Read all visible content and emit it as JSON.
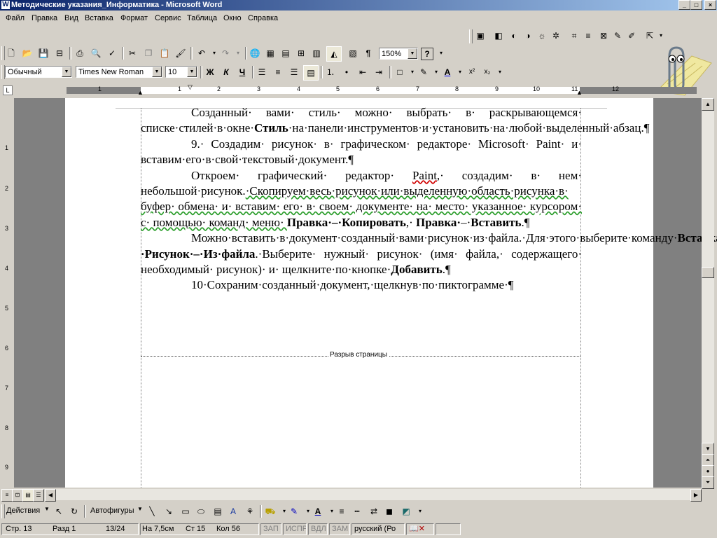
{
  "window": {
    "title": "Методические указания_Информатика - Microsoft Word",
    "min": "_",
    "max": "□",
    "close": "×"
  },
  "menu": [
    "Файл",
    "Правка",
    "Вид",
    "Вставка",
    "Формат",
    "Сервис",
    "Таблица",
    "Окно",
    "Справка"
  ],
  "formatting": {
    "style": "Обычный",
    "font": "Times New Roman",
    "size": "10",
    "bold": "Ж",
    "italic": "К",
    "underline": "Ч"
  },
  "standard": {
    "zoom": "150%",
    "help": "?"
  },
  "ruler_numbers": [
    "1",
    "1",
    "2",
    "3",
    "4",
    "5",
    "6",
    "7",
    "8",
    "9",
    "10",
    "11",
    "12"
  ],
  "vruler_numbers": [
    "1",
    "2",
    "3",
    "4",
    "5",
    "6",
    "7",
    "8",
    "9"
  ],
  "document": {
    "p1_a": "Созданный· вами· стиль· можно· выбрать· в· раскрывающемся· списке·стилей·в·окне·",
    "p1_b": "Стиль",
    "p1_c": "·на·панели·инструментов·и·установить·на·любой·выделенный·абзац.¶",
    "p2": "9.· Создадим· рисунок· в· графическом· редакторе· Microsoft· Paint· и· вставим·его·в·свой·текстовый·документ.¶",
    "p3_a": "Откроем· графический· редактор· ",
    "p3_b": "Paint",
    "p3_c": ",· создадим· в· нем· небольшой·рисунок.",
    "p3_d": "·Скопируем·весь·рисунок·или·выделенную·область·рисунка·в· буфер· обмена· и· вставим· его· в· своем· документе· на· место· указанное· курсором· с· помощью· команд· меню· ",
    "p3_e": "Правка·",
    "p3_f": "–·",
    "p3_g": "Копировать",
    "p3_h": ",· ",
    "p3_i": "Правка·",
    "p3_j": "–·",
    "p3_k": "Вставить",
    "p3_l": ".¶",
    "p4_a": "Можно·вставить·в·документ·созданный·вами·рисунок·из·файла.·Для·этого·выберите·команду·",
    "p4_b": "Вставка·–·Рисунок·–·Из·файла",
    "p4_c": ".·Выберите· нужный· рисунок· (имя· файла,· содержащего· необходимый· рисунок)· и· щелкните·по·кнопке·",
    "p4_d": "Добавить",
    "p4_e": ".¶",
    "p5": "10·Сохраним·созданный·документ,·щелкнув·по·пиктограмме·¶",
    "page_break": "Разрыв страницы"
  },
  "drawing": {
    "actions": "Действия",
    "autoshapes": "Автофигуры"
  },
  "status": {
    "page": "Стр.  13",
    "section": "Разд  1",
    "pages": "13/24",
    "at": "На 7,5см",
    "line": "Ст  15",
    "col": "Кол  56",
    "rec": "ЗАП",
    "trk": "ИСПР",
    "ext": "ВДЛ",
    "ovr": "ЗАМ",
    "lang": "русский (Ро"
  },
  "colors": {
    "titlebar_start": "#0a246a",
    "titlebar_end": "#a6caf0",
    "chrome": "#d4d0c8",
    "doc_bg": "#808080"
  }
}
